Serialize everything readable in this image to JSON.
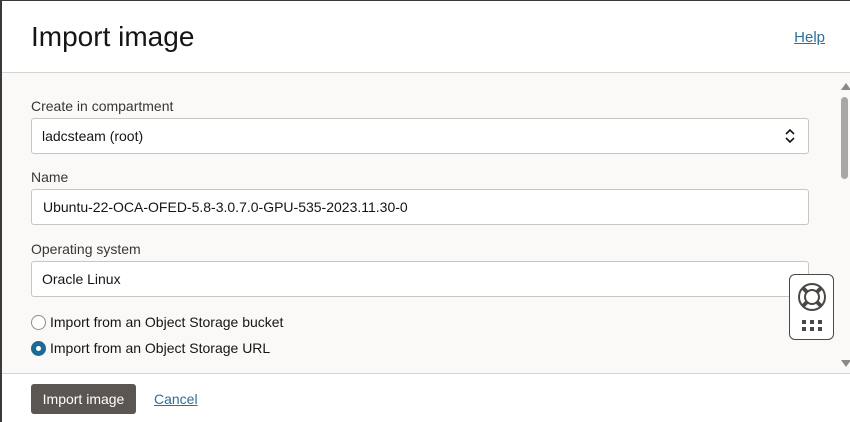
{
  "dialog": {
    "title": "Import image",
    "help_link": "Help"
  },
  "form": {
    "compartment": {
      "label": "Create in compartment",
      "value": "ladcsteam (root)"
    },
    "name": {
      "label": "Name",
      "value": "Ubuntu-22-OCA-OFED-5.8-3.0.7.0-GPU-535-2023.11.30-0"
    },
    "operating_system": {
      "label": "Operating system",
      "value": "Oracle Linux"
    },
    "import_source": {
      "options": [
        {
          "label": "Import from an Object Storage bucket",
          "checked": false
        },
        {
          "label": "Import from an Object Storage URL",
          "checked": true
        }
      ]
    }
  },
  "footer": {
    "primary_label": "Import image",
    "cancel_label": "Cancel"
  },
  "colors": {
    "link": "#2d6f9a",
    "primary_button": "#5b5652",
    "radio_selected": "#1d6a94"
  },
  "icons": {
    "help_widget": "life-ring-icon",
    "apps_grid": "grid-icon"
  }
}
